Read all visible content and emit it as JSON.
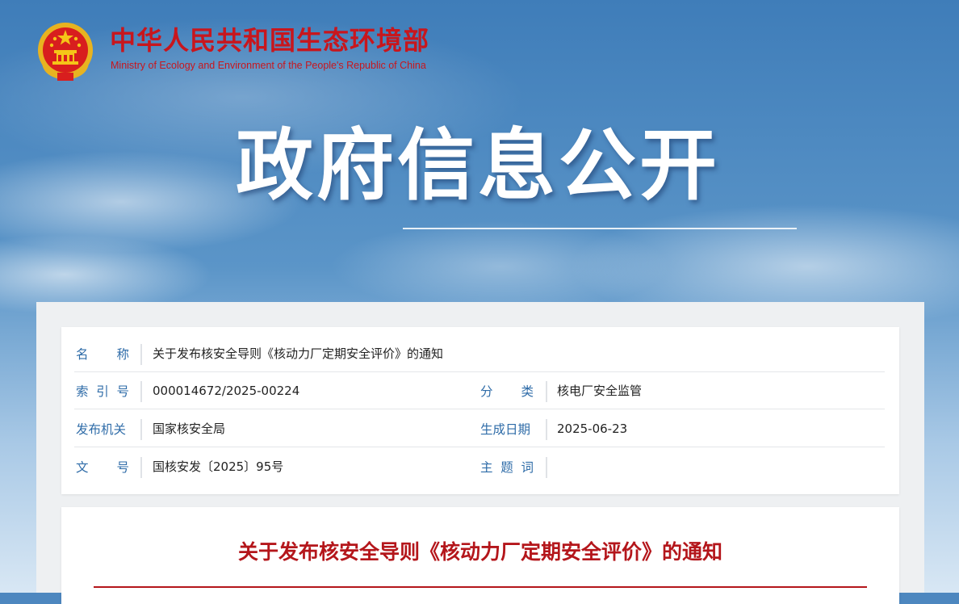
{
  "header": {
    "emblem_icon": "national-emblem-icon",
    "ministry_cn": "中华人民共和国生态环境部",
    "ministry_en": "Ministry of Ecology and Environment of the People's Republic of China"
  },
  "banner": {
    "title": "政府信息公开"
  },
  "meta": {
    "name_label_chars": [
      "名",
      "称"
    ],
    "name_value": "关于发布核安全导则《核动力厂定期安全评价》的通知",
    "index_label_chars": [
      "索",
      "引",
      "号"
    ],
    "index_value": "000014672/2025-00224",
    "category_label_chars": [
      "分",
      "类"
    ],
    "category_value": "核电厂安全监管",
    "issuer_label": "发布机关",
    "issuer_value": "国家核安全局",
    "date_label": "生成日期",
    "date_value": "2025-06-23",
    "docno_label_chars": [
      "文",
      "号"
    ],
    "docno_value": "国核安发〔2025〕95号",
    "topic_label_chars": [
      "主",
      "题",
      "词"
    ],
    "topic_value": ""
  },
  "document": {
    "title": "关于发布核安全导则《核动力厂定期安全评价》的通知"
  },
  "colors": {
    "brand_red": "#c8161d",
    "label_blue": "#2f6ca8",
    "title_red": "#b4161b"
  }
}
